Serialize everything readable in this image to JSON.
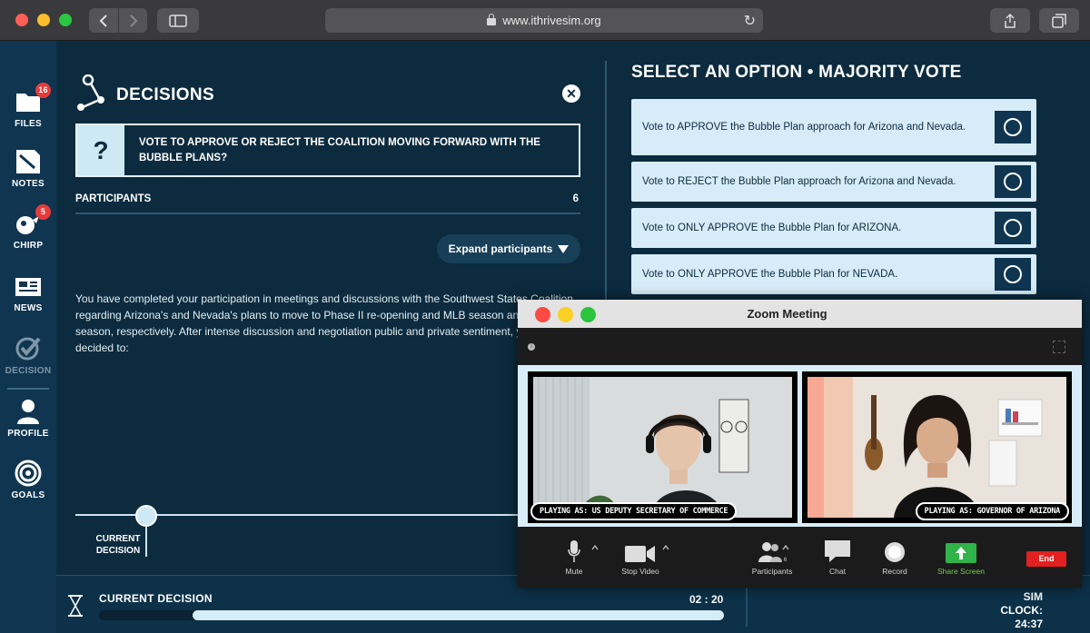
{
  "browser": {
    "url": "www.ithrivesim.org",
    "traffic_colors": [
      "#ff5f57",
      "#febc2e",
      "#28c840"
    ]
  },
  "sidebar": {
    "items": [
      {
        "label": "FILES",
        "icon": "files-icon",
        "badge": "16"
      },
      {
        "label": "NOTES",
        "icon": "notes-icon"
      },
      {
        "label": "CHIRP",
        "icon": "chirp-icon",
        "badge": "5"
      },
      {
        "label": "NEWS",
        "icon": "news-icon"
      },
      {
        "label": "DECISION",
        "icon": "decision-icon"
      },
      {
        "label": "PROFILE",
        "icon": "profile-icon"
      },
      {
        "label": "GOALS",
        "icon": "goals-icon"
      }
    ]
  },
  "decisions": {
    "title": "DECISIONS",
    "question_mark": "?",
    "question": "VOTE TO APPROVE OR REJECT THE COALITION MOVING FORWARD WITH THE BUBBLE PLANS?",
    "participants_label": "PARTICIPANTS",
    "participants_count": "6",
    "expand_label": "Expand participants",
    "body": "You have completed your participation in meetings and discussions with the Southwest States Coalition regarding Arizona's and Nevada's plans to move to Phase II re-opening and MLB season and the NFL season, respectively. After intense discussion and negotiation public and private sentiment, you have decided to:",
    "timeline_label": "CURRENT DECISION"
  },
  "options": {
    "title": "SELECT AN OPTION • MAJORITY VOTE",
    "items": [
      "Vote to APPROVE the Bubble Plan approach for Arizona and Nevada.",
      "Vote to REJECT the Bubble Plan approach for Arizona and Nevada.",
      "Vote to ONLY APPROVE the Bubble Plan for ARIZONA.",
      "Vote to ONLY APPROVE the Bubble Plan for NEVADA."
    ]
  },
  "bottom": {
    "current_decision": "CURRENT DECISION",
    "timer": "02 : 20",
    "progress_fraction": 0.85,
    "sim_clock_label": "SIM CLOCK:",
    "sim_clock_value": "24:37"
  },
  "zoom": {
    "title": "Zoom Meeting",
    "tile1_label": "PLAYING AS: US DEPUTY SECRETARY OF COMMERCE",
    "tile2_label": "PLAYING AS: GOVERNOR OF ARIZONA",
    "participants_count": "6",
    "tools": {
      "mute": "Mute",
      "stop_video": "Stop Video",
      "participants": "Participants",
      "chat": "Chat",
      "record": "Record",
      "share_screen": "Share Screen",
      "end": "End"
    }
  }
}
